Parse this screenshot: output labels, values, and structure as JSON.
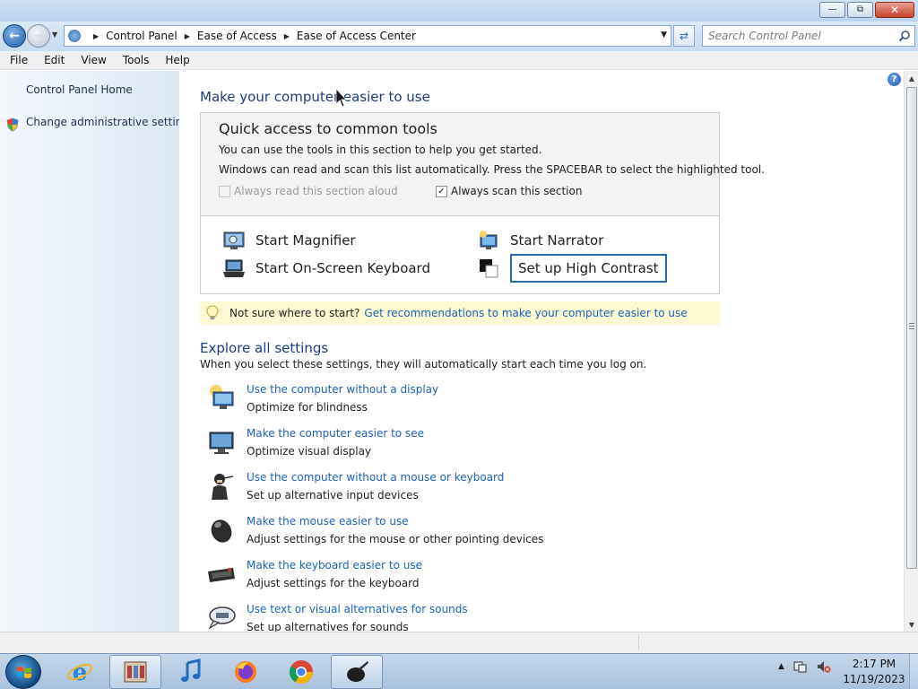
{
  "window": {
    "controls": {
      "minimize": "—",
      "maximize": "⧉",
      "close": "✕"
    }
  },
  "address": {
    "breadcrumbs": [
      "Control Panel",
      "Ease of Access",
      "Ease of Access Center"
    ],
    "search_placeholder": "Search Control Panel"
  },
  "menu": [
    "File",
    "Edit",
    "View",
    "Tools",
    "Help"
  ],
  "sidebar": {
    "items": [
      {
        "label": "Control Panel Home"
      },
      {
        "label": "Change administrative settings",
        "icon": "shield-icon"
      }
    ]
  },
  "main": {
    "title": "Make your computer easier to use",
    "help_icon": "?",
    "quick_access": {
      "heading": "Quick access to common tools",
      "line1": "You can use the tools in this section to help you get started.",
      "line2": "Windows can read and scan this list automatically.  Press the SPACEBAR to select the highlighted tool.",
      "read_aloud": {
        "label": "Always read this section aloud",
        "checked": false,
        "enabled": false
      },
      "scan": {
        "label": "Always scan this section",
        "checked": true,
        "enabled": true
      },
      "tools": [
        {
          "label": "Start Magnifier",
          "icon": "magnifier-icon"
        },
        {
          "label": "Start Narrator",
          "icon": "narrator-icon"
        },
        {
          "label": "Start On-Screen Keyboard",
          "icon": "keyboard-icon"
        },
        {
          "label": "Set up High Contrast",
          "icon": "high-contrast-icon",
          "focused": true
        }
      ]
    },
    "tip": {
      "prefix": "Not sure where to start?",
      "link": "Get recommendations to make your computer easier to use"
    },
    "explore": {
      "title": "Explore all settings",
      "subtitle": "When you select these settings, they will automatically start each time you log on.",
      "items": [
        {
          "link": "Use the computer without a display",
          "desc": "Optimize for blindness",
          "icon": "monitor-sun-icon"
        },
        {
          "link": "Make the computer easier to see",
          "desc": "Optimize visual display",
          "icon": "monitor-icon"
        },
        {
          "link": "Use the computer without a mouse or keyboard",
          "desc": "Set up alternative input devices",
          "icon": "person-headset-icon"
        },
        {
          "link": "Make the mouse easier to use",
          "desc": "Adjust settings for the mouse or other pointing devices",
          "icon": "mouse-icon"
        },
        {
          "link": "Make the keyboard easier to use",
          "desc": "Adjust settings for the keyboard",
          "icon": "keyboard-icon"
        },
        {
          "link": "Use text or visual alternatives for sounds",
          "desc": "Set up alternatives for sounds",
          "icon": "speech-bubble-icon"
        }
      ]
    }
  },
  "taskbar": {
    "apps": [
      "internet-explorer-icon",
      "control-panel-icon",
      "music-icon",
      "firefox-icon",
      "chrome-icon",
      "ink-app-icon"
    ],
    "active_app": "ink-app-icon",
    "clock": {
      "time": "2:17 PM",
      "date": "11/19/2023"
    }
  },
  "colors": {
    "link": "#1a62b9",
    "title": "#1c3d7e",
    "tip_bg": "#fdf9d2"
  }
}
